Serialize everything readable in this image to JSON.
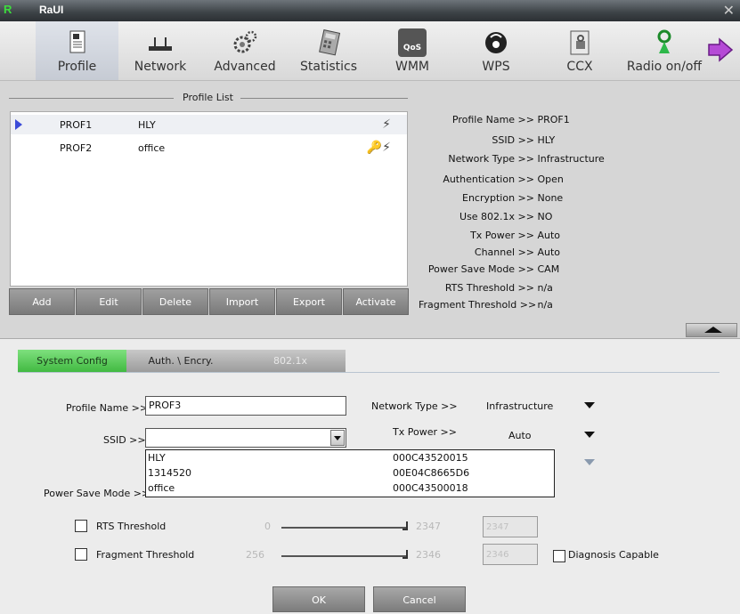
{
  "window": {
    "title": "RaUI",
    "logo_letter": "R",
    "close_glyph": "✕"
  },
  "toolbar": {
    "items": [
      {
        "label": "Profile",
        "icon": "profile-icon"
      },
      {
        "label": "Network",
        "icon": "network-icon"
      },
      {
        "label": "Advanced",
        "icon": "advanced-icon"
      },
      {
        "label": "Statistics",
        "icon": "statistics-icon"
      },
      {
        "label": "WMM",
        "icon": "wmm-icon"
      },
      {
        "label": "WPS",
        "icon": "wps-icon"
      },
      {
        "label": "CCX",
        "icon": "ccx-icon"
      },
      {
        "label": "Radio on/off",
        "icon": "radio-icon"
      }
    ],
    "wmm_badge": "QoS"
  },
  "profile_list": {
    "title": "Profile List",
    "rows": [
      {
        "name": "PROF1",
        "ssid": "HLY",
        "icons": "⚡"
      },
      {
        "name": "PROF2",
        "ssid": "office",
        "icons": "🔑⚡"
      }
    ]
  },
  "profile_buttons": {
    "add": "Add",
    "edit": "Edit",
    "delete": "Delete",
    "import": "Import",
    "export": "Export",
    "activate": "Activate"
  },
  "profile_info": [
    {
      "key": "Profile Name >>",
      "value": "PROF1"
    },
    {
      "key": "SSID >>",
      "value": "HLY"
    },
    {
      "key": "Network Type >>",
      "value": "Infrastructure"
    },
    {
      "key": "Authentication >>",
      "value": "Open"
    },
    {
      "key": "Encryption >>",
      "value": "None"
    },
    {
      "key": "Use 802.1x >>",
      "value": "NO"
    },
    {
      "key": "Tx Power >>",
      "value": "Auto"
    },
    {
      "key": "Channel >>",
      "value": "Auto"
    },
    {
      "key": "Power Save Mode >>",
      "value": "CAM"
    },
    {
      "key": "RTS Threshold >>",
      "value": "n/a"
    },
    {
      "key": "Fragment Threshold >>",
      "value": "n/a"
    }
  ],
  "tabs": {
    "system_config": "System Config",
    "auth_encry": "Auth. \\ Encry.",
    "dot1x": "802.1x"
  },
  "form": {
    "profile_name_label": "Profile Name >>",
    "profile_name_value": "PROF3",
    "ssid_label": "SSID >>",
    "ssid_value": "",
    "network_type_label": "Network Type >>",
    "network_type_value": "Infrastructure",
    "tx_power_label": "Tx Power >>",
    "tx_power_value": "Auto",
    "power_save_label": "Power Save Mode >>",
    "rts_label": "RTS Threshold",
    "rts_min": "0",
    "rts_max": "2347",
    "rts_value": "2347",
    "frag_label": "Fragment Threshold",
    "frag_min": "256",
    "frag_max": "2346",
    "frag_value": "2346",
    "diagnosis_label": "Diagnosis Capable"
  },
  "ssid_dropdown": [
    {
      "ssid": "HLY",
      "mac": "000C43520015"
    },
    {
      "ssid": "1314520",
      "mac": "00E04C8665D6"
    },
    {
      "ssid": "office",
      "mac": "000C43500018"
    }
  ],
  "dialog_buttons": {
    "ok": "OK",
    "cancel": "Cancel"
  },
  "colors": {
    "active_tab": "#3fb83f",
    "selection_arrow": "#3b4bd8",
    "titlebar": "#3c4246"
  }
}
